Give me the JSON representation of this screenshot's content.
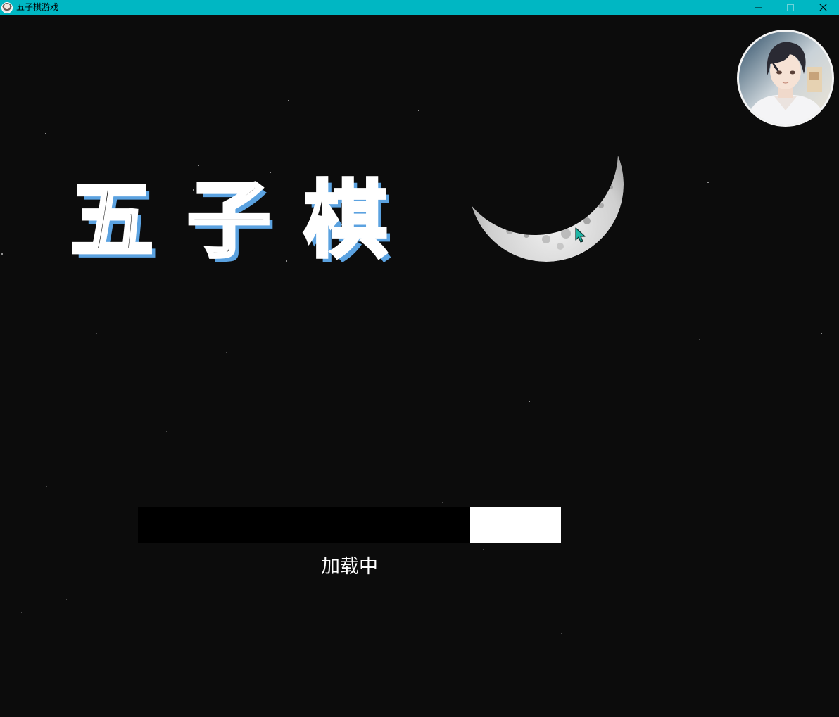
{
  "window": {
    "title": "五子棋游戏",
    "title_bar_color": "#00b7c3",
    "controls": [
      "minimize-icon",
      "maximize-icon",
      "close-icon"
    ]
  },
  "logo": {
    "text": "五子棋",
    "fill_color": "#121212",
    "outline_color": "#ffffff",
    "shadow_color": "#5ba2e0"
  },
  "loading": {
    "label": "加载中",
    "progress_fraction": 0.786,
    "fill_color": "#000000",
    "track_color": "#ffffff"
  },
  "background_color": "#0c0c0c",
  "icons": {
    "avatar": "user-avatar",
    "moon": "crescent-moon",
    "cursor": "mouse-pointer"
  }
}
